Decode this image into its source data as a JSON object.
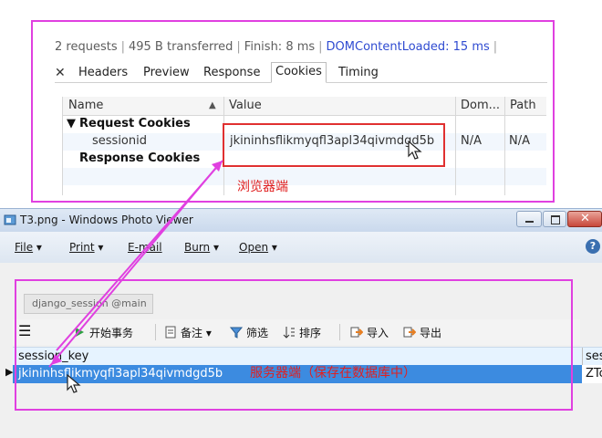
{
  "devtools": {
    "summary": {
      "requests": "2 requests",
      "transferred": "495 B transferred",
      "finish": "Finish: 8 ms",
      "dom_loaded": "DOMContentLoaded: 15 ms"
    },
    "tabs": [
      "Headers",
      "Preview",
      "Response",
      "Cookies",
      "Timing"
    ],
    "active_tab": "Cookies",
    "columns": [
      "Name",
      "Value",
      "Dom...",
      "Path"
    ],
    "rows": [
      {
        "name": "Request Cookies",
        "value": "",
        "domain": "",
        "path": ""
      },
      {
        "name": "sessionid",
        "value": "jkininhsflikmyqfl3apl34qivmdgd5b",
        "domain": "N/A",
        "path": "N/A"
      },
      {
        "name": "Response Cookies",
        "value": "",
        "domain": "",
        "path": ""
      }
    ]
  },
  "annotations": {
    "browser_label": "浏览器端",
    "server_label": "服务器端（保存在数据库中）"
  },
  "photo_viewer": {
    "title": "T3.png - Windows Photo Viewer",
    "menu": [
      {
        "label": "File",
        "has_dropdown": true
      },
      {
        "label": "Print",
        "has_dropdown": true
      },
      {
        "label": "E-mail",
        "has_dropdown": false
      },
      {
        "label": "Burn",
        "has_dropdown": true
      },
      {
        "label": "Open",
        "has_dropdown": true
      }
    ],
    "help_icon": "help-icon",
    "navicat": {
      "tab_label": "django_session @main",
      "toolbar": [
        "开始事务",
        "备注",
        "筛选",
        "排序",
        "导入",
        "导出"
      ],
      "column_header": "session_key",
      "column_header_right": "ses",
      "row_value": "jkininhsflikmyqfl3apl34qivmdgd5b",
      "row_value_right": "ZTc"
    }
  },
  "colors": {
    "annotation_pink": "#e040e0",
    "annotation_red": "#e03030",
    "selected_row": "#3c8be0"
  }
}
